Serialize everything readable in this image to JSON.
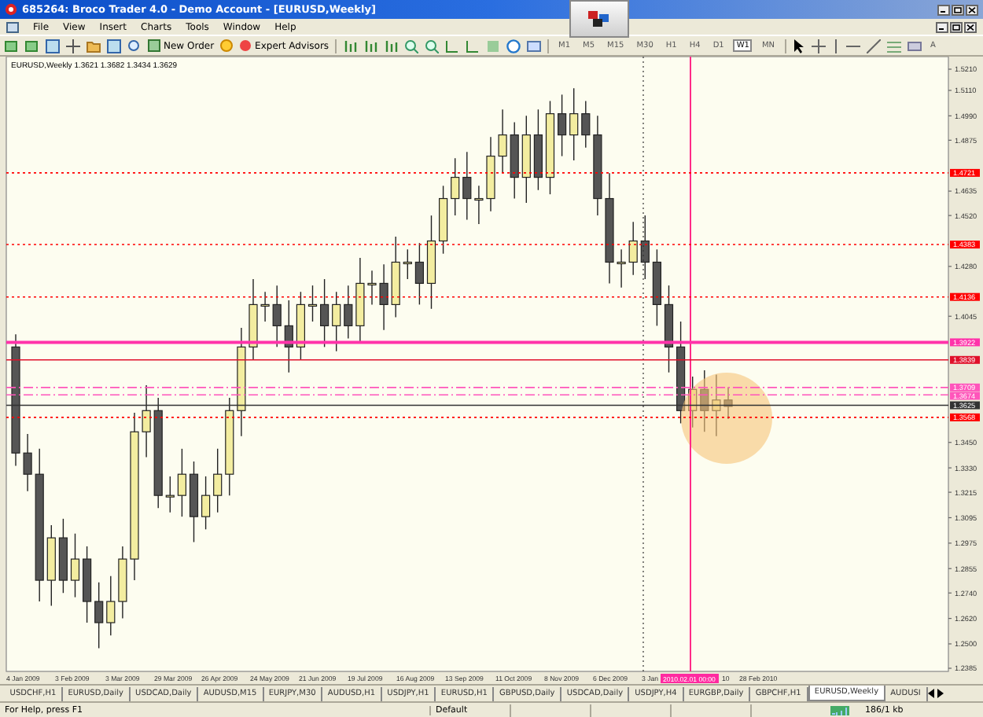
{
  "window": {
    "title": "685264: Broco Trader 4.0 - Demo Account - [EURUSD,Weekly]"
  },
  "menu": [
    "File",
    "View",
    "Insert",
    "Charts",
    "Tools",
    "Window",
    "Help"
  ],
  "toolbar": {
    "new_order": "New Order",
    "expert_advisors": "Expert Advisors",
    "text_tool": "A",
    "timeframes": [
      {
        "label": "M1",
        "selected": false
      },
      {
        "label": "M5",
        "selected": false
      },
      {
        "label": "M15",
        "selected": false
      },
      {
        "label": "M30",
        "selected": false
      },
      {
        "label": "H1",
        "selected": false
      },
      {
        "label": "H4",
        "selected": false
      },
      {
        "label": "D1",
        "selected": false
      },
      {
        "label": "W1",
        "selected": true
      },
      {
        "label": "MN",
        "selected": false
      }
    ]
  },
  "chart": {
    "info": "EURUSD,Weekly  1.3621 1.3682 1.3434 1.3629",
    "price_ticks": [
      "1.5210",
      "1.5110",
      "1.4990",
      "1.4875",
      "1.4635",
      "1.4520",
      "1.4280",
      "1.4045",
      "1.3450",
      "1.3330",
      "1.3215",
      "1.3095",
      "1.2975",
      "1.2855",
      "1.2740",
      "1.2620",
      "1.2500",
      "1.2385"
    ],
    "lines": [
      {
        "label": "1.4721",
        "kind": "dotted",
        "color": "#ff0000"
      },
      {
        "label": "1.4383",
        "kind": "dotted",
        "color": "#ff0000"
      },
      {
        "label": "1.4136",
        "kind": "dotted",
        "color": "#ff0000"
      },
      {
        "label": "1.3922",
        "kind": "thick",
        "color": "#ff33aa"
      },
      {
        "label": "1.3839",
        "kind": "solid",
        "color": "#e0102a"
      },
      {
        "label": "1.3709",
        "kind": "dashdot",
        "color": "#ff55bb"
      },
      {
        "label": "1.3674",
        "kind": "dashdot",
        "color": "#ff55bb"
      },
      {
        "label": "1.3625",
        "kind": "solid",
        "color": "#333333"
      },
      {
        "label": "1.3568",
        "kind": "dotted",
        "color": "#ff0000"
      }
    ],
    "dates": [
      "4 Jan 2009",
      "3 Feb 2009",
      "3 Mar 2009",
      "29 Mar 2009",
      "26 Apr 2009",
      "24 May 2009",
      "21 Jun 2009",
      "19 Jul 2009",
      "16 Aug 2009",
      "13 Sep 2009",
      "11 Oct 2009",
      "8 Nov 2009",
      "6 Dec 2009",
      "3 Jan",
      "10",
      "28 Feb 2010"
    ],
    "crosshair_time": "2010.02.01 00:00"
  },
  "tabs": [
    {
      "label": "USDCHF,H1",
      "selected": false
    },
    {
      "label": "EURUSD,Daily",
      "selected": false
    },
    {
      "label": "USDCAD,Daily",
      "selected": false
    },
    {
      "label": "AUDUSD,M15",
      "selected": false
    },
    {
      "label": "EURJPY,M30",
      "selected": false
    },
    {
      "label": "AUDUSD,H1",
      "selected": false
    },
    {
      "label": "USDJPY,H1",
      "selected": false
    },
    {
      "label": "EURUSD,H1",
      "selected": false
    },
    {
      "label": "GBPUSD,Daily",
      "selected": false
    },
    {
      "label": "USDCAD,Daily",
      "selected": false
    },
    {
      "label": "USDJPY,H4",
      "selected": false
    },
    {
      "label": "EURGBP,Daily",
      "selected": false
    },
    {
      "label": "GBPCHF,H1",
      "selected": false
    },
    {
      "label": "EURUSD,Weekly",
      "selected": true
    },
    {
      "label": "AUDUSI",
      "selected": false
    }
  ],
  "status_bar": {
    "help": "For Help, press F1",
    "profile": "Default",
    "traffic": "186/1 kb"
  }
}
